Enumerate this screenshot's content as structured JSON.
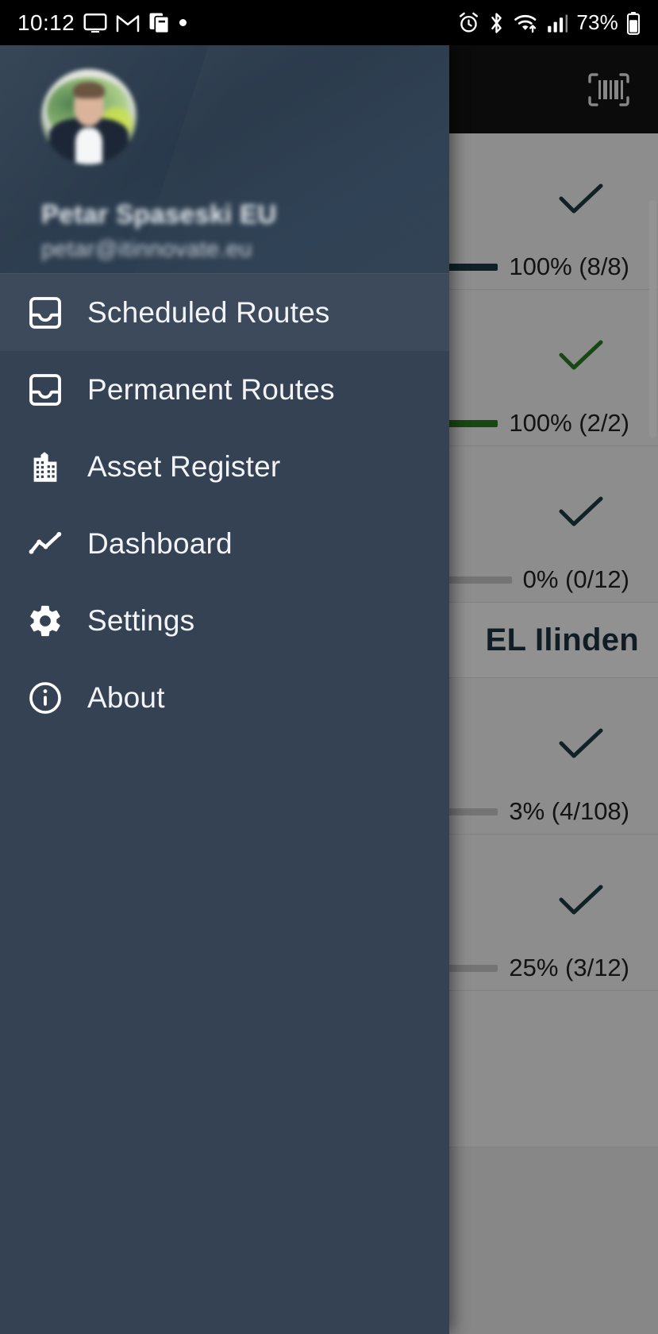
{
  "status_bar": {
    "time": "10:12",
    "battery_percent": "73%",
    "left_icons": [
      "cast-screen-icon",
      "gmail-icon",
      "files-copy-icon",
      "dot-icon"
    ],
    "right_icons": [
      "alarm-icon",
      "bluetooth-icon",
      "wifi-icon",
      "cellular-signal-icon"
    ]
  },
  "app_bar": {
    "scan_icon": "barcode-scan-icon"
  },
  "drawer": {
    "user_name": "Petar Spaseski EU",
    "user_email": "petar@itinnovate.eu",
    "avatar_icon": "user-avatar-photo",
    "items": [
      {
        "label": "Scheduled Routes",
        "icon": "inbox-icon",
        "active": true
      },
      {
        "label": "Permanent Routes",
        "icon": "inbox-icon",
        "active": false
      },
      {
        "label": "Asset Register",
        "icon": "building-icon",
        "active": false
      },
      {
        "label": "Dashboard",
        "icon": "line-chart-icon",
        "active": false
      },
      {
        "label": "Settings",
        "icon": "gear-icon",
        "active": false
      },
      {
        "label": "About",
        "icon": "info-circle-icon",
        "active": false
      }
    ]
  },
  "content": {
    "section_header": "EL Ilinden",
    "rows": [
      {
        "check_icon": "check-icon",
        "check_color": "#1d3b40",
        "progress_percent": 100,
        "progress_label": "100% (8/8)",
        "bar_color": "#1d3b40"
      },
      {
        "check_icon": "check-icon",
        "check_color": "#2a7d1f",
        "progress_percent": 100,
        "progress_label": "100% (2/2)",
        "bar_color": "#2a7d1f"
      },
      {
        "check_icon": "check-icon",
        "check_color": "#1d3b40",
        "progress_percent": 0,
        "progress_label": "0% (0/12)",
        "bar_color": "#9a9a9a"
      },
      {
        "check_icon": "check-icon",
        "check_color": "#1d3b40",
        "progress_percent": 3,
        "progress_label": "3% (4/108)",
        "bar_color": "#7e7e7e"
      },
      {
        "check_icon": "check-icon",
        "check_color": "#1d3b40",
        "progress_percent": 25,
        "progress_label": "25% (3/12)",
        "bar_color": "#7e7e7e"
      }
    ]
  },
  "colors": {
    "drawer_bg": "#344253",
    "drawer_active": "#3c4a5b",
    "header_bg": "#2c3d4f",
    "appbar_bg": "#131313",
    "accent_dark": "#1d3b40",
    "accent_green": "#2a7d1f"
  }
}
